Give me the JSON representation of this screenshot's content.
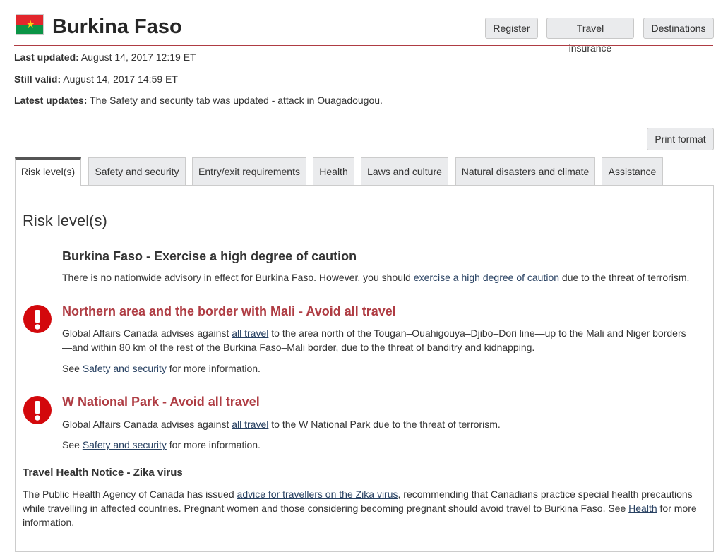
{
  "header": {
    "title": "Burkina Faso",
    "buttons": {
      "register": "Register",
      "insurance": "Travel insurance",
      "destinations": "Destinations"
    }
  },
  "meta": {
    "last_updated_label": "Last updated:",
    "last_updated_value": "August 14, 2017 12:19 ET",
    "still_valid_label": "Still valid:",
    "still_valid_value": "August 14, 2017 14:59 ET",
    "latest_updates_label": "Latest updates:",
    "latest_updates_value": "The Safety and security tab was updated - attack in Ouagadougou."
  },
  "print_format": "Print format",
  "tabs": [
    {
      "label": "Risk level(s)"
    },
    {
      "label": "Safety and security"
    },
    {
      "label": "Entry/exit requirements"
    },
    {
      "label": "Health"
    },
    {
      "label": "Laws and culture"
    },
    {
      "label": "Natural disasters and climate"
    },
    {
      "label": "Assistance"
    }
  ],
  "content": {
    "heading": "Risk level(s)",
    "national": {
      "title": "Burkina Faso - Exercise a high degree of caution",
      "text_before": "There is no nationwide advisory in effect for Burkina Faso. However, you should ",
      "link": "exercise a high degree of caution",
      "text_after": " due to the threat of terrorism."
    },
    "north": {
      "title": "Northern area and the border with Mali - Avoid all travel",
      "text_before": "Global Affairs Canada advises against ",
      "link": "all travel",
      "text_after_line1": " to the area north of the Tougan–Ouahigouya–Djibo–Dori line—up to the Mali and Niger borders",
      "text_line2": "—and within 80 km of the rest of the Burkina Faso–Mali border, due to the threat of banditry and kidnapping.",
      "see": "See ",
      "see_link": "Safety and security",
      "see_after": " for more information."
    },
    "park": {
      "title": "W National Park - Avoid all travel",
      "text_before": "Global Affairs Canada advises against ",
      "link": "all travel",
      "text_after": " to the W National Park due to the threat of terrorism.",
      "see": "See ",
      "see_link": "Safety and security",
      "see_after": " for more information."
    },
    "health_notice": {
      "title": "Travel Health Notice - Zika virus",
      "text_before": "The Public Health Agency of Canada has issued ",
      "link": "advice for travellers on the Zika virus",
      "text_after_line1": ", recommending that Canadians practice special health precautions",
      "text_line2_before": "while travelling in affected countries. Pregnant women and those considering becoming pregnant should avoid travel to Burkina Faso. See ",
      "link2": "Health",
      "text_line2_after": " for more",
      "text_line3": "information."
    }
  },
  "colors": {
    "accent_red": "#af3c43",
    "link": "#284162",
    "alert_red": "#d3080c"
  }
}
